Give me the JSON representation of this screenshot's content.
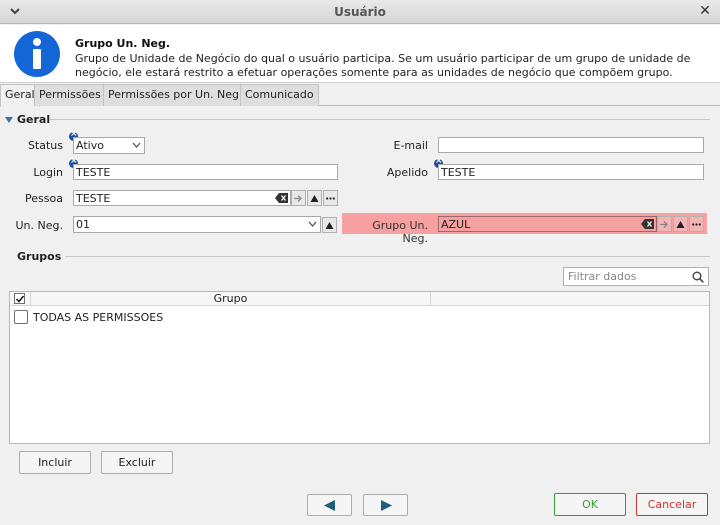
{
  "window": {
    "title": "Usuário"
  },
  "info": {
    "heading": "Grupo Un. Neg.",
    "description": "Grupo de Unidade de Negócio do qual o usuário participa. Se um usuário participar de um grupo de unidade de negócio, ele estará restrito a efetuar operações somente para as unidades de negócio que compõem grupo."
  },
  "tabs": [
    {
      "label": "Geral"
    },
    {
      "label": "Permissões"
    },
    {
      "label": "Permissões por Un. Neg."
    },
    {
      "label": "Comunicado"
    }
  ],
  "section": {
    "title": "Geral"
  },
  "form": {
    "status": {
      "label": "Status",
      "value": "Ativo"
    },
    "email": {
      "label": "E-mail",
      "value": ""
    },
    "login": {
      "label": "Login",
      "value": "TESTE"
    },
    "apelido": {
      "label": "Apelido",
      "value": "TESTE"
    },
    "pessoa": {
      "label": "Pessoa",
      "value": "TESTE"
    },
    "un_neg": {
      "label": "Un. Neg.",
      "value": "01"
    },
    "grupo_un_neg": {
      "label": "Grupo Un. Neg.",
      "value": "AZUL"
    }
  },
  "grupos": {
    "title": "Grupos",
    "filter_placeholder": "Filtrar dados",
    "columns": [
      "Grupo"
    ],
    "rows": [
      {
        "grupo": "TODAS AS PERMISSOES"
      }
    ],
    "incluir": "Incluir",
    "excluir": "Excluir"
  },
  "footer": {
    "ok": "OK",
    "cancel": "Cancelar"
  },
  "colors": {
    "accent": "#1c4fa0",
    "highlight": "#f6a0a0",
    "ok": "#3a9a3a",
    "cancel": "#cc3333"
  }
}
